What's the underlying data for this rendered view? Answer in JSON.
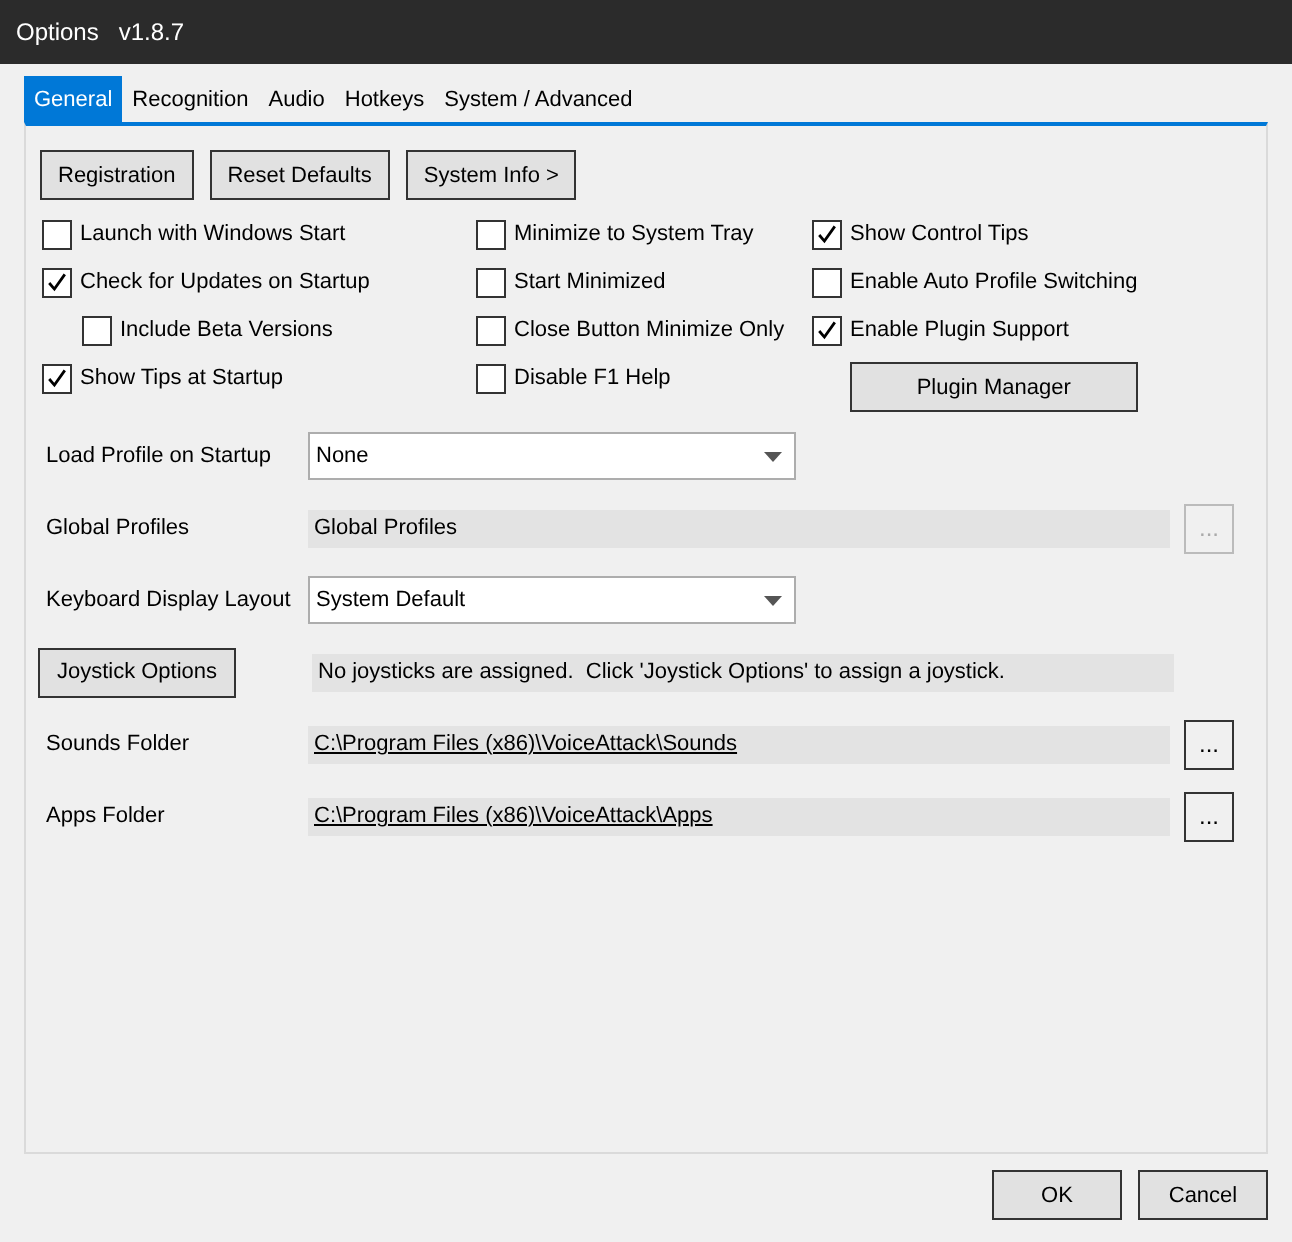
{
  "window": {
    "title": "Options",
    "version": "v1.8.7"
  },
  "tabs": [
    {
      "label": "General",
      "selected": true
    },
    {
      "label": "Recognition",
      "selected": false
    },
    {
      "label": "Audio",
      "selected": false
    },
    {
      "label": "Hotkeys",
      "selected": false
    },
    {
      "label": "System / Advanced",
      "selected": false
    }
  ],
  "top_buttons": [
    "Registration",
    "Reset Defaults",
    "System Info >"
  ],
  "option_columns": [
    [
      {
        "kind": "checkbox",
        "label": "Launch with Windows Start",
        "checked": false
      },
      {
        "kind": "checkbox",
        "label": "Check for Updates on Startup",
        "checked": true,
        "children": [
          {
            "kind": "checkbox",
            "label": "Include Beta Versions",
            "checked": false
          }
        ]
      },
      {
        "kind": "checkbox",
        "label": "Show Tips at Startup",
        "checked": true
      }
    ],
    [
      {
        "kind": "checkbox",
        "label": "Minimize to System Tray",
        "checked": false
      },
      {
        "kind": "checkbox",
        "label": "Start Minimized",
        "checked": false
      },
      {
        "kind": "checkbox",
        "label": "Close Button Minimize Only",
        "checked": false
      },
      {
        "kind": "checkbox",
        "label": "Disable F1 Help",
        "checked": false
      }
    ],
    [
      {
        "kind": "checkbox",
        "label": "Show Control Tips",
        "checked": true
      },
      {
        "kind": "checkbox",
        "label": "Enable Auto Profile Switching",
        "checked": false
      },
      {
        "kind": "checkbox",
        "label": "Enable Plugin Support",
        "checked": true
      },
      {
        "kind": "button",
        "label": "Plugin Manager"
      }
    ]
  ],
  "settings": [
    {
      "kind": "dropdown",
      "label": "Load Profile on Startup",
      "value": "None"
    },
    {
      "kind": "readonly",
      "label": "Global Profiles",
      "value": "Global Profiles",
      "browse": {
        "label": "...",
        "disabled": true
      }
    },
    {
      "kind": "dropdown",
      "label": "Keyboard Display Layout",
      "value": "System Default"
    },
    {
      "kind": "button_message",
      "label": "Joystick Options",
      "value": "No joysticks are assigned.  Click 'Joystick Options' to assign a joystick."
    },
    {
      "kind": "path",
      "label": "Sounds Folder",
      "value": "C:\\Program Files (x86)\\VoiceAttack\\Sounds",
      "browse": {
        "label": "...",
        "disabled": false
      }
    },
    {
      "kind": "path",
      "label": "Apps Folder",
      "value": "C:\\Program Files (x86)\\VoiceAttack\\Apps",
      "browse": {
        "label": "...",
        "disabled": false
      }
    }
  ],
  "footer_buttons": [
    "OK",
    "Cancel"
  ]
}
